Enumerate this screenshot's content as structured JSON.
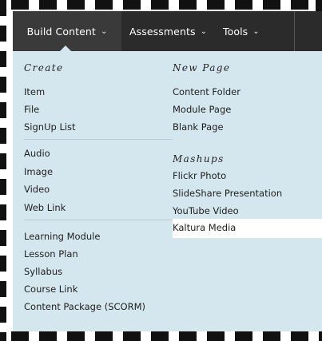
{
  "nav": {
    "tabs": [
      {
        "label": "Build Content",
        "chevron": "⌄"
      },
      {
        "label": "Assessments",
        "chevron": "⌄"
      },
      {
        "label": "Tools",
        "chevron": "⌄"
      }
    ]
  },
  "menu": {
    "create": {
      "heading": "Create",
      "group1": [
        "Item",
        "File",
        "SignUp List"
      ],
      "group2": [
        "Audio",
        "Image",
        "Video",
        "Web Link"
      ],
      "group3": [
        "Learning Module",
        "Lesson Plan",
        "Syllabus",
        "Course Link",
        "Content Package (SCORM)"
      ]
    },
    "new_page": {
      "heading": "New Page",
      "items": [
        "Content Folder",
        "Module Page",
        "Blank Page"
      ]
    },
    "mashups": {
      "heading": "Mashups",
      "items": [
        "Flickr Photo",
        "SlideShare Presentation",
        "YouTube Video",
        "Kaltura Media"
      ],
      "highlighted": "Kaltura Media"
    }
  },
  "colors": {
    "nav_bg": "#2b2b2b",
    "menu_bg": "#d4e6ee",
    "highlight_bg": "#ffffff",
    "text": "#1f1f1f"
  }
}
